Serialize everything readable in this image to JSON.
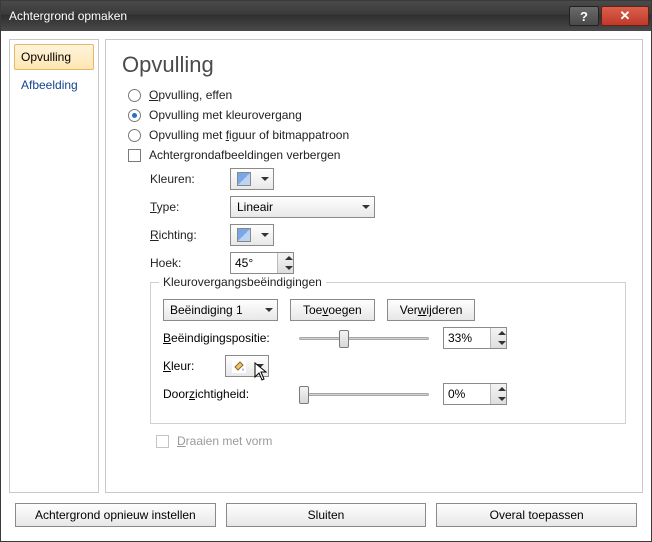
{
  "window": {
    "title": "Achtergrond opmaken"
  },
  "sidebar": {
    "items": [
      {
        "label": "Opvulling",
        "active": true
      },
      {
        "label": "Afbeelding",
        "active": false
      }
    ]
  },
  "main": {
    "heading": "Opvulling",
    "options": {
      "solid": "Opvulling, effen",
      "gradient": "Opvulling met kleurovergang",
      "picture": "Opvulling met figuur of bitmappatroon",
      "hide_bg": "Achtergrondafbeeldingen verbergen"
    },
    "labels": {
      "colors": "Kleuren:",
      "type": "Type:",
      "direction": "Richting:",
      "angle": "Hoek:",
      "stops_legend": "Kleurovergangsbeëindigingen",
      "stop_position": "Beëindigingspositie:",
      "color": "Kleur:",
      "transparency": "Doorzichtigheid:",
      "rotate": "Draaien met vorm"
    },
    "values": {
      "type": "Lineair",
      "angle": "45°",
      "stop_selected": "Beëindiging 1",
      "position": "33%",
      "transparency": "0%",
      "position_slider_pct": 33,
      "transparency_slider_pct": 0
    },
    "buttons": {
      "add": "Toevoegen",
      "remove": "Verwijderen"
    }
  },
  "footer": {
    "reset": "Achtergrond opnieuw instellen",
    "close": "Sluiten",
    "apply_all": "Overal toepassen"
  }
}
